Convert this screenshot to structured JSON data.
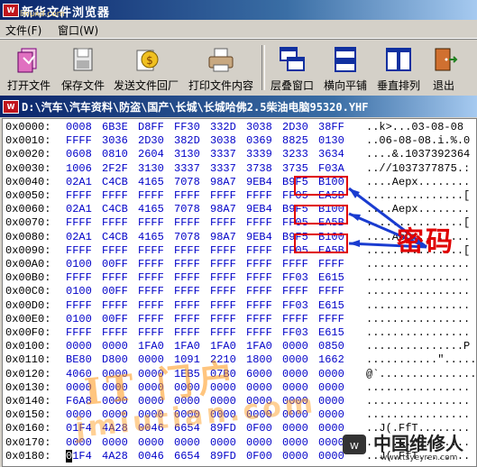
{
  "window": {
    "title": "新华文件浏览器",
    "watermark": "linuxd.com",
    "icon": "app-logo-icon"
  },
  "menu": [
    "文件(F)",
    "窗口(W)"
  ],
  "toolbar": [
    {
      "label": "打开文件",
      "icon": "open-file-icon"
    },
    {
      "label": "保存文件",
      "icon": "save-file-icon"
    },
    {
      "label": "发送文件回厂",
      "icon": "send-file-icon"
    },
    {
      "label": "打印文件内容",
      "icon": "print-icon"
    },
    {
      "label": "层叠窗口",
      "icon": "cascade-windows-icon"
    },
    {
      "label": "横向平铺",
      "icon": "tile-horizontal-icon"
    },
    {
      "label": "垂直排列",
      "icon": "tile-vertical-icon"
    },
    {
      "label": "退出",
      "icon": "exit-icon"
    }
  ],
  "document": {
    "path": "D:\\汽车\\汽车资料\\防盗\\国产\\长城\\长城哈佛2.5柴油电脑95320.YHF"
  },
  "hex_rows": [
    {
      "addr": "0x0000:",
      "words": [
        "0008",
        "6B3E",
        "D8FF",
        "FF30",
        "332D",
        "3038",
        "2D30",
        "38FF"
      ],
      "ascii": "..k>...03-08-08"
    },
    {
      "addr": "0x0010:",
      "words": [
        "FFFF",
        "3036",
        "2D30",
        "382D",
        "3038",
        "0369",
        "8825",
        "0130"
      ],
      "ascii": "..06-08-08.i.%.0"
    },
    {
      "addr": "0x0020:",
      "words": [
        "0608",
        "0810",
        "2604",
        "3130",
        "3337",
        "3339",
        "3233",
        "3634"
      ],
      "ascii": "....&.1037392364"
    },
    {
      "addr": "0x0030:",
      "words": [
        "1006",
        "2F2F",
        "3130",
        "3337",
        "3337",
        "3738",
        "3735",
        "F03A"
      ],
      "ascii": "..//1037377875.:"
    },
    {
      "addr": "0x0040:",
      "words": [
        "02A1",
        "C4CB",
        "4165",
        "7078",
        "98A7",
        "9EB4",
        "B9F5",
        "B100"
      ],
      "ascii": "....Aepx........"
    },
    {
      "addr": "0x0050:",
      "words": [
        "FFFF",
        "FFFF",
        "FFFF",
        "FFFF",
        "FFFF",
        "FFFF",
        "FF05",
        "EA5B"
      ],
      "ascii": "...............["
    },
    {
      "addr": "0x0060:",
      "words": [
        "02A1",
        "C4CB",
        "4165",
        "7078",
        "98A7",
        "9EB4",
        "B9F5",
        "B100"
      ],
      "ascii": "....Aepx........"
    },
    {
      "addr": "0x0070:",
      "words": [
        "FFFF",
        "FFFF",
        "FFFF",
        "FFFF",
        "FFFF",
        "FFFF",
        "FF05",
        "EA5B"
      ],
      "ascii": "...............["
    },
    {
      "addr": "0x0080:",
      "words": [
        "02A1",
        "C4CB",
        "4165",
        "7078",
        "98A7",
        "9EB4",
        "B9F5",
        "B100"
      ],
      "ascii": "....Aepx........"
    },
    {
      "addr": "0x0090:",
      "words": [
        "FFFF",
        "FFFF",
        "FFFF",
        "FFFF",
        "FFFF",
        "FFFF",
        "FF05",
        "EA5B"
      ],
      "ascii": "...............["
    },
    {
      "addr": "0x00A0:",
      "words": [
        "0100",
        "00FF",
        "FFFF",
        "FFFF",
        "FFFF",
        "FFFF",
        "FFFF",
        "FFFF"
      ],
      "ascii": "................"
    },
    {
      "addr": "0x00B0:",
      "words": [
        "FFFF",
        "FFFF",
        "FFFF",
        "FFFF",
        "FFFF",
        "FFFF",
        "FF03",
        "E615"
      ],
      "ascii": "................"
    },
    {
      "addr": "0x00C0:",
      "words": [
        "0100",
        "00FF",
        "FFFF",
        "FFFF",
        "FFFF",
        "FFFF",
        "FFFF",
        "FFFF"
      ],
      "ascii": "................"
    },
    {
      "addr": "0x00D0:",
      "words": [
        "FFFF",
        "FFFF",
        "FFFF",
        "FFFF",
        "FFFF",
        "FFFF",
        "FF03",
        "E615"
      ],
      "ascii": "................"
    },
    {
      "addr": "0x00E0:",
      "words": [
        "0100",
        "00FF",
        "FFFF",
        "FFFF",
        "FFFF",
        "FFFF",
        "FFFF",
        "FFFF"
      ],
      "ascii": "................"
    },
    {
      "addr": "0x00F0:",
      "words": [
        "FFFF",
        "FFFF",
        "FFFF",
        "FFFF",
        "FFFF",
        "FFFF",
        "FF03",
        "E615"
      ],
      "ascii": "................"
    },
    {
      "addr": "0x0100:",
      "words": [
        "0000",
        "0000",
        "1FA0",
        "1FA0",
        "1FA0",
        "1FA0",
        "0000",
        "0850"
      ],
      "ascii": "...............P"
    },
    {
      "addr": "0x0110:",
      "words": [
        "BE80",
        "D800",
        "0000",
        "1091",
        "2210",
        "1800",
        "0000",
        "1662"
      ],
      "ascii": "...........\".....b"
    },
    {
      "addr": "0x0120:",
      "words": [
        "4060",
        "0000",
        "0000",
        "1EB5",
        "07B0",
        "6000",
        "0000",
        "0000"
      ],
      "ascii": "@`..............."
    },
    {
      "addr": "0x0130:",
      "words": [
        "0000",
        "0000",
        "0000",
        "0000",
        "0000",
        "0000",
        "0000",
        "0000"
      ],
      "ascii": "................"
    },
    {
      "addr": "0x0140:",
      "words": [
        "F6A8",
        "0000",
        "0000",
        "0000",
        "0000",
        "0000",
        "0000",
        "0000"
      ],
      "ascii": "................"
    },
    {
      "addr": "0x0150:",
      "words": [
        "0000",
        "0000",
        "0000",
        "0000",
        "0000",
        "0000",
        "0000",
        "0000"
      ],
      "ascii": "................"
    },
    {
      "addr": "0x0160:",
      "words": [
        "01F4",
        "4A28",
        "0046",
        "6654",
        "89FD",
        "0F00",
        "0000",
        "0000"
      ],
      "ascii": "..J(.FfT........"
    },
    {
      "addr": "0x0170:",
      "words": [
        "0000",
        "0000",
        "0000",
        "0000",
        "0000",
        "0000",
        "0000",
        "0000"
      ],
      "ascii": "................"
    },
    {
      "addr": "0x0180:",
      "words": [
        "01F4",
        "4A28",
        "0046",
        "6654",
        "89FD",
        "0F00",
        "0000",
        "0000"
      ],
      "ascii": "..J(.FfT........"
    }
  ],
  "annotation": {
    "label": "密码",
    "color": "#e00000"
  },
  "watermarks": {
    "center_cn": "IT 门户",
    "center_url": "jmiutian.com",
    "corner": "中国维修人",
    "corner_url": "www.tsyeyren.com"
  },
  "colors": {
    "hex_words": "#0000c8",
    "title_bar": "#0a246a",
    "annotation": "#e00000"
  }
}
